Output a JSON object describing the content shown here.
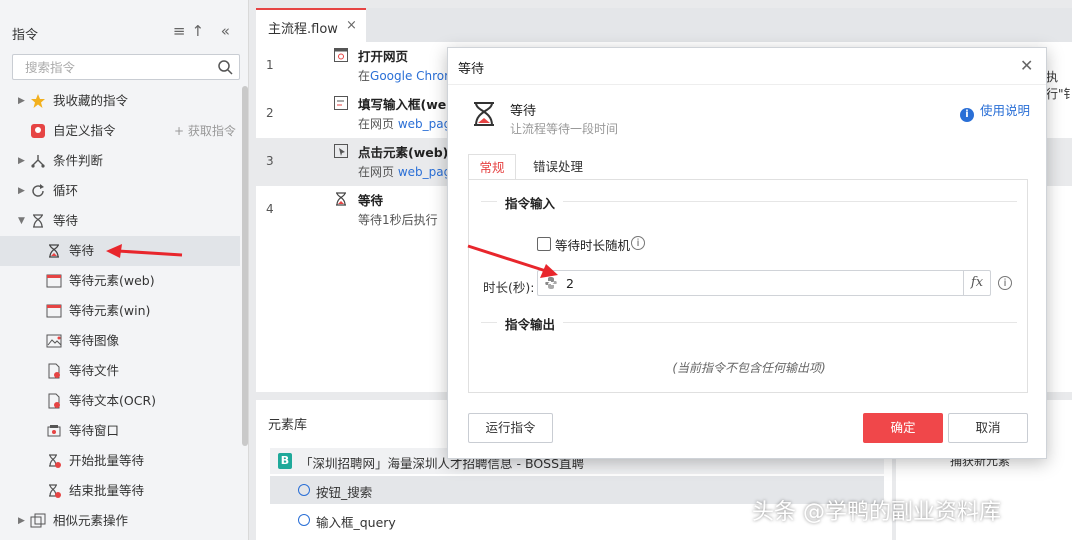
{
  "sidebar": {
    "title": "指令",
    "tools": "≡↑ «",
    "search_placeholder": "搜索指令",
    "items": [
      {
        "label": "我收藏的指令",
        "icon": "star-icon"
      },
      {
        "label": "自定义指令",
        "icon": "custom-command-icon",
        "action": "+ 获取指令"
      },
      {
        "label": "条件判断",
        "icon": "branch-icon"
      },
      {
        "label": "循环",
        "icon": "loop-icon"
      },
      {
        "label": "等待",
        "icon": "hourglass-icon"
      },
      {
        "label": "等待",
        "icon": "hourglass-icon"
      },
      {
        "label": "等待元素(web)",
        "icon": "wait-element-web-icon"
      },
      {
        "label": "等待元素(win)",
        "icon": "wait-element-win-icon"
      },
      {
        "label": "等待图像",
        "icon": "wait-image-icon"
      },
      {
        "label": "等待文件",
        "icon": "wait-file-icon"
      },
      {
        "label": "等待文本(OCR)",
        "icon": "wait-text-ocr-icon"
      },
      {
        "label": "等待窗口",
        "icon": "wait-window-icon"
      },
      {
        "label": "开始批量等待",
        "icon": "start-batch-wait-icon"
      },
      {
        "label": "结束批量等待",
        "icon": "end-batch-wait-icon"
      },
      {
        "label": "相似元素操作",
        "icon": "similar-elements-icon"
      }
    ]
  },
  "tab": {
    "label": "主流程.flow",
    "close": "×"
  },
  "steps": [
    {
      "num": "1",
      "title": "打开网页",
      "sub_prefix": "在",
      "sub_link": "Google Chrom",
      "sub_suffix": ""
    },
    {
      "num": "2",
      "title": "填写输入框(web",
      "sub_prefix": "在网页 ",
      "sub_link": "web_pag",
      "sub_suffix": ""
    },
    {
      "num": "3",
      "title": "点击元素(web)",
      "sub_prefix": "在网页 ",
      "sub_link": "web_pag",
      "sub_suffix": ""
    },
    {
      "num": "4",
      "title": "等待",
      "sub_prefix": "等待1秒后执行",
      "sub_link": "",
      "sub_suffix": ""
    }
  ],
  "edge_text": "执行\"钅",
  "element_library": {
    "title": "元素库",
    "group": "「深圳招聘网」海量深圳人才招聘信息 - BOSS直聘",
    "items": [
      "按钮_搜索",
      "输入框_query"
    ],
    "capture": "捕获新元素"
  },
  "modal": {
    "title": "等待",
    "command_name": "等待",
    "command_desc": "让流程等待一段时间",
    "help": "使用说明",
    "tabs": [
      "常规",
      "错误处理"
    ],
    "input_section": "指令输入",
    "random_label": "等待时长随机",
    "duration_label": "时长(秒):",
    "duration_value": "2",
    "fx": "fx",
    "output_section": "指令输出",
    "no_output": "(当前指令不包含任何输出项)",
    "run_button": "运行指令",
    "ok_button": "确定",
    "cancel_button": "取消"
  },
  "watermark": "头条 @学鸭的副业资料库",
  "colors": {
    "accent": "#e64444",
    "link": "#2a6fd6",
    "ok": "#f0474a"
  }
}
